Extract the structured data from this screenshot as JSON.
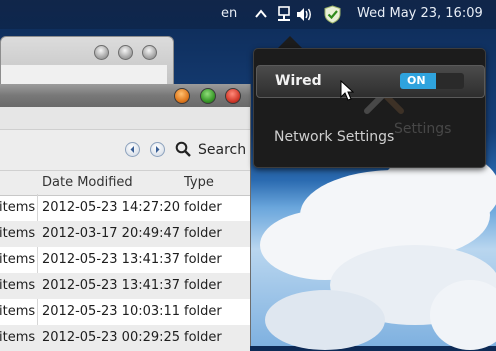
{
  "panel": {
    "language": "en",
    "clock": "Wed May 23, 16:09",
    "icons": [
      "chevron-up-icon",
      "network-wired-icon",
      "volume-icon",
      "shield-icon"
    ]
  },
  "file_window": {
    "search_label": "Search",
    "columns": [
      "Date Modified",
      "Type"
    ],
    "rows": [
      {
        "size": "items",
        "date": "2012-05-23 14:27:20",
        "type": "folder"
      },
      {
        "size": "items",
        "date": "2012-03-17 20:49:47",
        "type": "folder"
      },
      {
        "size": "items",
        "date": "2012-05-23 13:41:37",
        "type": "folder"
      },
      {
        "size": "items",
        "date": "2012-05-23 13:41:37",
        "type": "folder"
      },
      {
        "size": "items",
        "date": "2012-05-23 10:03:11",
        "type": "folder"
      },
      {
        "size": "items",
        "date": "2012-05-23 00:29:25",
        "type": "folder"
      }
    ]
  },
  "network_popup": {
    "wired_label": "Wired",
    "toggle_state": "ON",
    "settings_label": "Network Settings",
    "ghost_label": "Settings"
  },
  "colors": {
    "toggle_on": "#2fa3dd",
    "popup_bg": "#1c1c1c",
    "close_red": "#d33b2c",
    "max_green": "#3a9a2a",
    "min_orange": "#e07a1f"
  }
}
